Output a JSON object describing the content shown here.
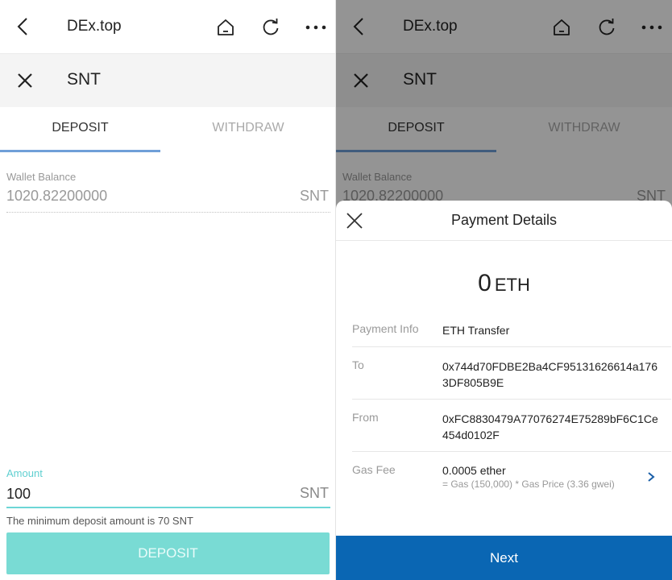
{
  "browser": {
    "title": "DEx.top"
  },
  "asset": {
    "title": "SNT"
  },
  "tabs": {
    "deposit": "DEPOSIT",
    "withdraw": "WITHDRAW"
  },
  "wallet": {
    "label": "Wallet Balance",
    "value": "1020.82200000",
    "unit": "SNT"
  },
  "amount": {
    "label": "Amount",
    "value": "100",
    "unit": "SNT",
    "note": "The minimum deposit amount is 70 SNT"
  },
  "deposit_button": "DEPOSIT",
  "payment": {
    "title": "Payment Details",
    "amount": "0",
    "currency": "ETH",
    "info_label": "Payment Info",
    "info_value": "ETH Transfer",
    "to_label": "To",
    "to_value": "0x744d70FDBE2Ba4CF95131626614a1763DF805B9E",
    "from_label": "From",
    "from_value": "0xFC8830479A77076274E75289bF6C1Ce454d0102F",
    "gas_label": "Gas Fee",
    "gas_value": "0.0005 ether",
    "gas_detail": "= Gas (150,000) * Gas Price (3.36 gwei)",
    "next_button": "Next"
  },
  "colors": {
    "accent_tab": "#6f9fd8",
    "amount_accent": "#5fcfd0",
    "deposit_button": "#79dbd4",
    "next_button": "#0a66b3"
  },
  "icons": [
    "back-icon",
    "home-icon",
    "refresh-icon",
    "more-icon",
    "close-icon",
    "chevron-right-icon"
  ]
}
